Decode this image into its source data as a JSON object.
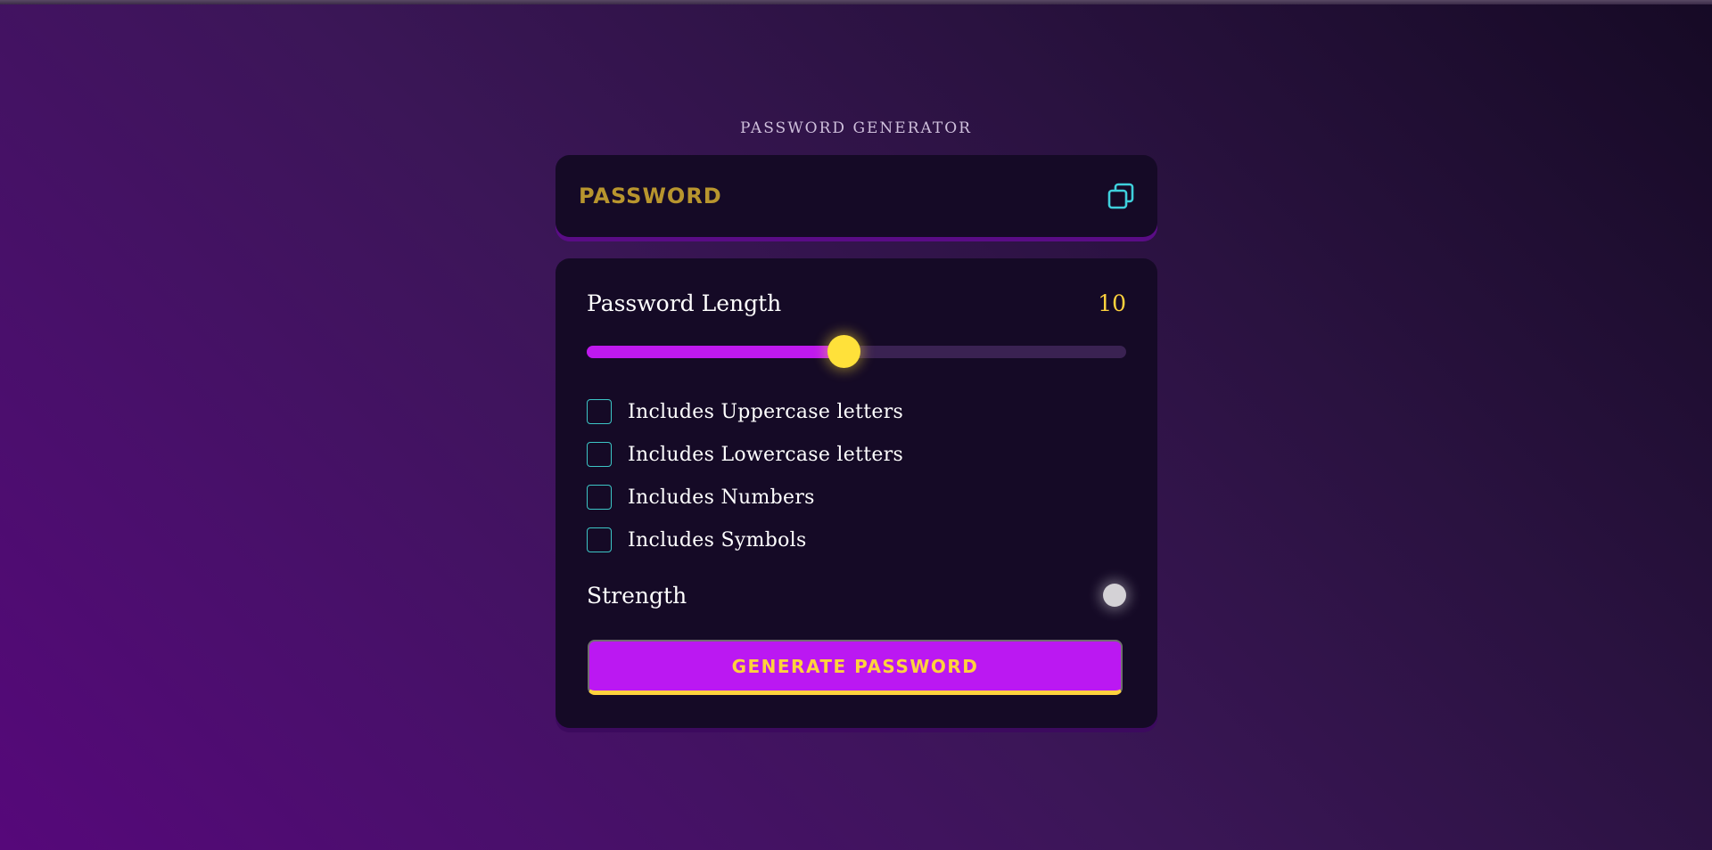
{
  "app": {
    "title": "PASSWORD GENERATOR"
  },
  "display": {
    "placeholder": "PASSWORD",
    "value": "",
    "copy_icon": "copy-icon"
  },
  "length": {
    "label": "Password Length",
    "value": "10",
    "slider_fraction": 0.476
  },
  "options": [
    {
      "label": "Includes Uppercase letters",
      "checked": false
    },
    {
      "label": "Includes Lowercase letters",
      "checked": false
    },
    {
      "label": "Includes Numbers",
      "checked": false
    },
    {
      "label": "Includes Symbols",
      "checked": false
    }
  ],
  "strength": {
    "label": "Strength",
    "indicator_color": "#d4d2d6"
  },
  "generate": {
    "label": "GENERATE PASSWORD"
  },
  "colors": {
    "accent_purple": "#bb18f2",
    "accent_yellow": "#ffd23d",
    "checkbox_border": "#3cc6c6",
    "panel_bg": "#150a26"
  }
}
